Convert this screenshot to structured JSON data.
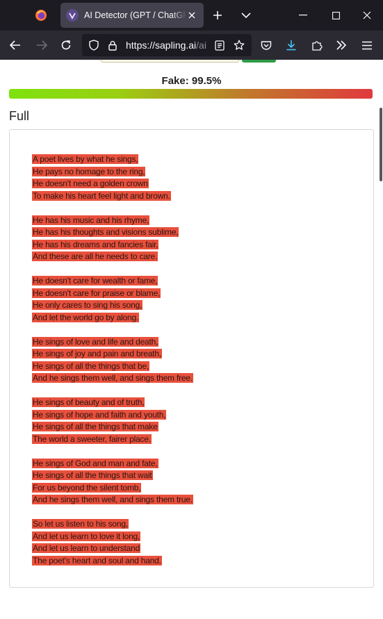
{
  "browser": {
    "tab": {
      "title": "AI Detector (GPT / ChatGPT) | Sapling"
    },
    "url": {
      "host": "https://sapling.ai",
      "path": "/ai-content-detector"
    }
  },
  "result": {
    "score_label": "Fake: 99.5%",
    "fake_fraction": 0.995,
    "section_title": "Full"
  },
  "poem": {
    "stanzas": [
      [
        "A poet lives by what he sings,",
        "He pays no homage to the ring,",
        "He doesn't need a golden crown",
        "To make his heart feel light and brown."
      ],
      [
        "He has his music and his rhyme,",
        "He has his thoughts and visions sublime,",
        "He has his dreams and fancies fair,",
        "And these are all he needs to care."
      ],
      [
        "He doesn't care for wealth or fame,",
        "He doesn't care for praise or blame,",
        "He only cares to sing his song,",
        "And let the world go by along."
      ],
      [
        "He sings of love and life and death,",
        "He sings of joy and pain and breath,",
        "He sings of all the things that be,",
        "And he sings them well, and sings them free."
      ],
      [
        "He sings of beauty and of truth,",
        "He sings of hope and faith and youth,",
        "He sings of all the things that make",
        "The world a sweeter, fairer place."
      ],
      [
        "He sings of God and man and fate,",
        "He sings of all the things that wait",
        "For us beyond the silent tomb,",
        "And he sings them well, and sings them true."
      ],
      [
        "So let us listen to his song,",
        "And let us learn to love it long,",
        "And let us learn to understand",
        "The poet's heart and soul and hand."
      ]
    ]
  },
  "colors": {
    "highlight": "#e8503c",
    "meter_start": "#7ee20e",
    "meter_end": "#e03a3c"
  }
}
